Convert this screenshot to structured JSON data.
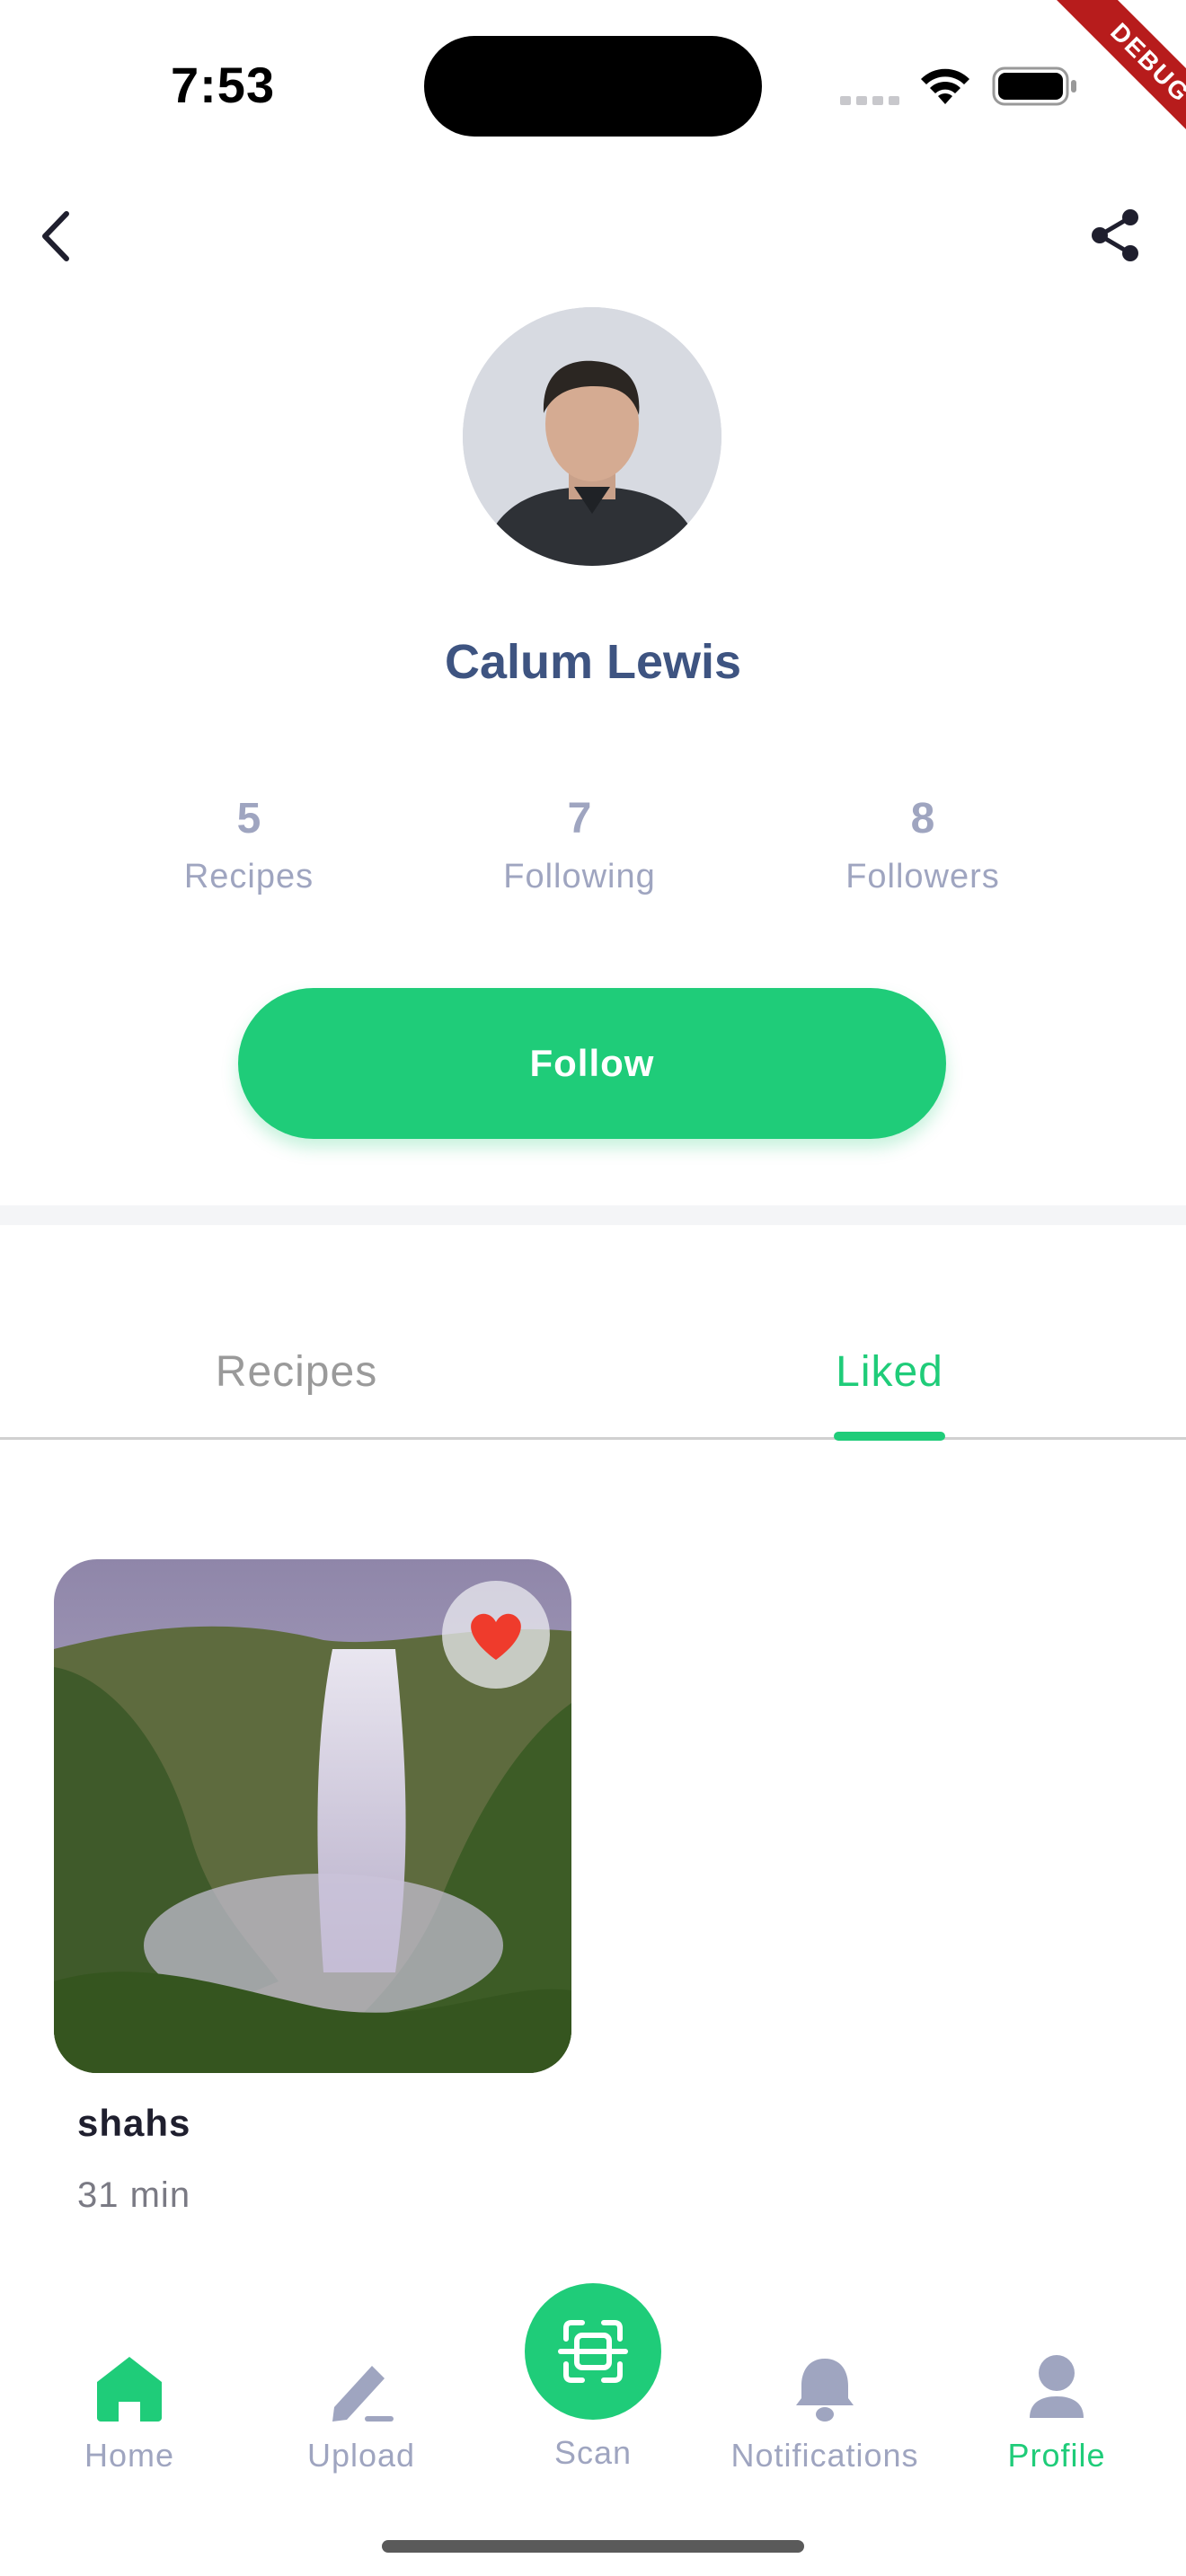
{
  "status_bar": {
    "time": "7:53",
    "debug_label": "DEBUG"
  },
  "profile": {
    "name": "Calum Lewis",
    "stats": [
      {
        "value": "5",
        "label": "Recipes"
      },
      {
        "value": "7",
        "label": "Following"
      },
      {
        "value": "8",
        "label": "Followers"
      }
    ],
    "follow_label": "Follow"
  },
  "tabs": [
    {
      "label": "Recipes",
      "active": false
    },
    {
      "label": "Liked",
      "active": true
    }
  ],
  "liked": [
    {
      "title": "shahs",
      "time": "31 min",
      "liked": true
    }
  ],
  "nav": [
    {
      "label": "Home",
      "icon": "home-icon",
      "active": false
    },
    {
      "label": "Upload",
      "icon": "pencil-icon",
      "active": false
    },
    {
      "label": "Scan",
      "icon": "scan-icon",
      "active": false
    },
    {
      "label": "Notifications",
      "icon": "bell-icon",
      "active": false
    },
    {
      "label": "Profile",
      "icon": "person-icon",
      "active": true
    }
  ],
  "colors": {
    "accent": "#1fcc79",
    "name": "#3e5481",
    "muted": "#9fa5c0"
  }
}
